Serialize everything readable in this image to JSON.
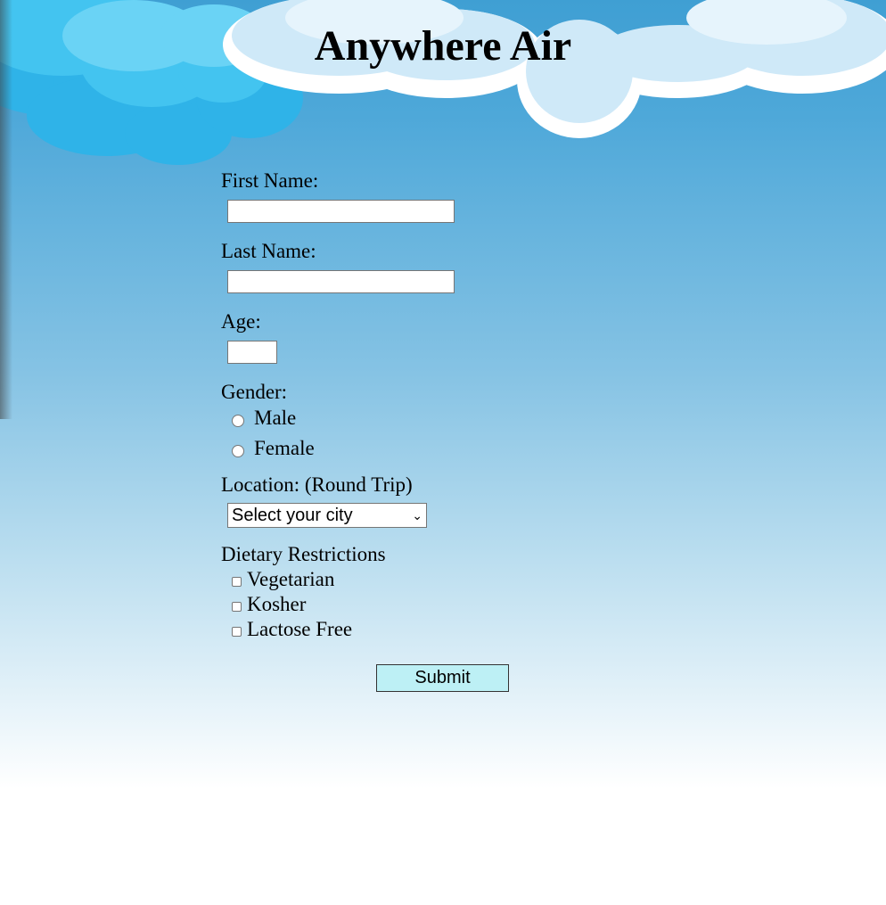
{
  "header": {
    "title": "Anywhere Air"
  },
  "form": {
    "first_name_label": "First Name:",
    "first_name_value": "",
    "last_name_label": "Last Name:",
    "last_name_value": "",
    "age_label": "Age:",
    "age_value": "",
    "gender_label": "Gender:",
    "gender_options": [
      "Male",
      "Female"
    ],
    "location_label": "Location: (Round Trip)",
    "location_selected": "Select your city",
    "dietary_label": "Dietary Restrictions",
    "dietary_options": [
      "Vegetarian",
      "Kosher",
      "Lactose Free"
    ],
    "submit_label": "Submit"
  },
  "colors": {
    "sky_top": "#3f9fd3",
    "sky_bottom": "#ffffff",
    "submit_bg": "#bdf0f5"
  }
}
